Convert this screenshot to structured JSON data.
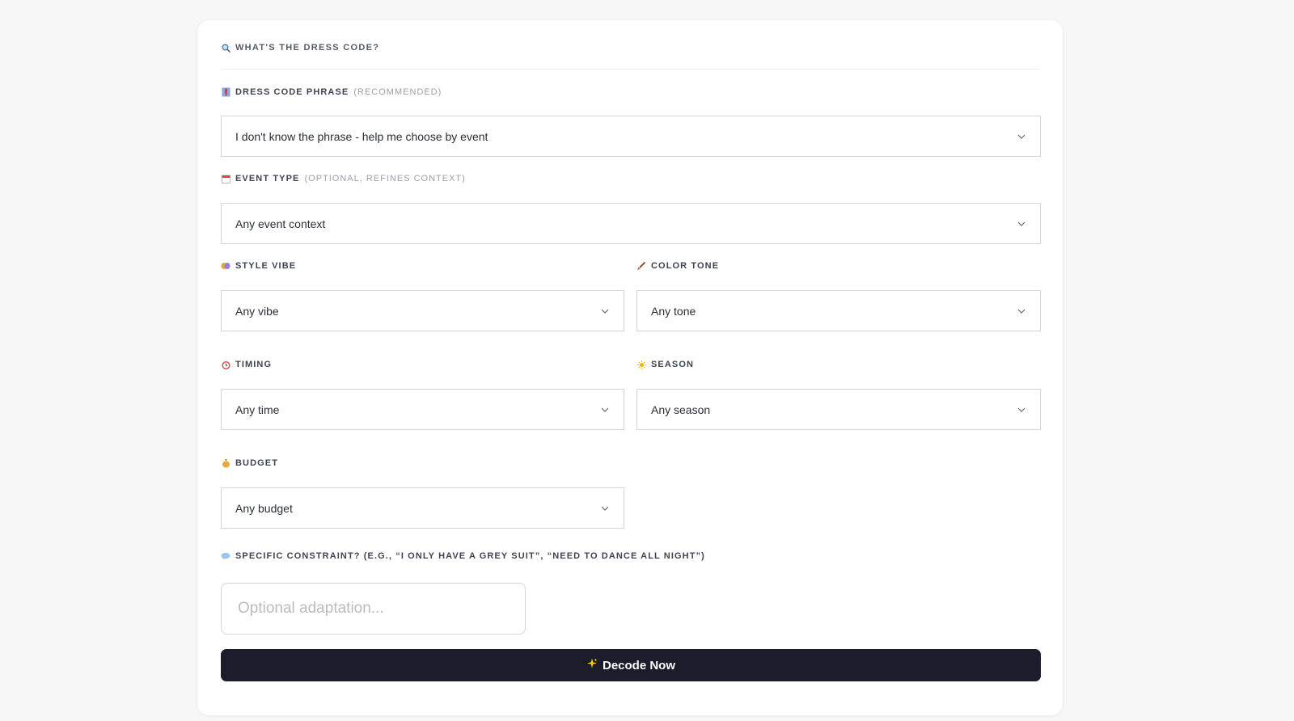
{
  "form": {
    "section_title": "What's the dress code?",
    "section_icon": "search-icon",
    "fields": {
      "phrase": {
        "icon": "tie-icon",
        "label": "Dress code phrase",
        "hint": "(recommended)",
        "value": "I don't know the phrase - help me choose by event"
      },
      "event_type": {
        "icon": "calendar-icon",
        "label": "Event type",
        "hint": "(optional, refines context)",
        "value": "Any event context"
      },
      "style_vibe": {
        "icon": "mask-icon",
        "label": "Style vibe",
        "value": "Any vibe"
      },
      "color_tone": {
        "icon": "paintbrush-icon",
        "label": "Color tone",
        "value": "Any tone"
      },
      "timing": {
        "icon": "alarm-clock-icon",
        "label": "Timing",
        "value": "Any time"
      },
      "season": {
        "icon": "sun-icon",
        "label": "Season",
        "value": "Any season"
      },
      "budget": {
        "icon": "money-bag-icon",
        "label": "Budget",
        "value": "Any budget"
      },
      "constraint": {
        "icon": "speech-bubble-icon",
        "label": "Specific constraint? (e.g., “I only have a grey suit”, “need to dance all night”)",
        "placeholder": "Optional adaptation..."
      }
    },
    "submit": {
      "icon": "sparkles-icon",
      "label": "Decode Now"
    }
  },
  "colors": {
    "button_bg": "#1b1c2c",
    "border": "#d2d5da",
    "page_bg": "#f7f7f7"
  }
}
